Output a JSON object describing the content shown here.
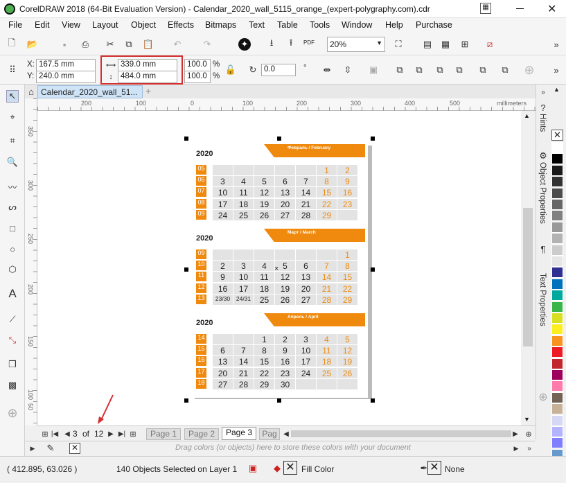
{
  "app": {
    "title": "CorelDRAW 2018 (64-Bit Evaluation Version) - Calendar_2020_wall_5115_orange_(expert-polygraphy.com).cdr"
  },
  "menu": [
    "File",
    "Edit",
    "View",
    "Layout",
    "Object",
    "Effects",
    "Bitmaps",
    "Text",
    "Table",
    "Tools",
    "Window",
    "Help",
    "Purchase"
  ],
  "toolbar": {
    "zoom": "20%",
    "pdf": "PDF"
  },
  "props": {
    "x": "167.5 mm",
    "y": "240.0 mm",
    "w": "339.0 mm",
    "h": "484.0 mm",
    "sx": "100.0",
    "sy": "100.0",
    "pct": "%",
    "angle": "0.0",
    "deg": "°"
  },
  "doc": {
    "tab": "Calendar_2020_wall_51..."
  },
  "ruler": {
    "ticks": [
      "200",
      "100",
      "0",
      "100",
      "200",
      "300",
      "400",
      "500"
    ],
    "unit": "millimeters",
    "vticks": [
      "350",
      "300",
      "250",
      "200",
      "150",
      "100",
      "50"
    ]
  },
  "pages": {
    "current": "3",
    "of": "of",
    "total": "12",
    "tabs": [
      "Page 1",
      "Page 2",
      "Page 3",
      "Pag"
    ]
  },
  "colorbar": {
    "hint": "Drag colors (or objects) here to store these colors with your document"
  },
  "status": {
    "coords": "( 412.895, 63.026 )",
    "selection": "140 Objects Selected on Layer 1",
    "fill": "Fill Color",
    "outline": "None"
  },
  "dockers": {
    "hints": "Hints",
    "object": "Object Properties",
    "text": "Text Properties"
  },
  "palette": [
    "#ffffff",
    "#000000",
    "#1a1a1a",
    "#333333",
    "#4d4d4d",
    "#666666",
    "#808080",
    "#999999",
    "#b3b3b3",
    "#cccccc",
    "#e6e6e6",
    "#2e3192",
    "#0071bc",
    "#00a99d",
    "#39b54a",
    "#d9e021",
    "#fcee21",
    "#f7931e",
    "#ed1c24",
    "#c1272d",
    "#9e005d",
    "#ff7bac",
    "#736357",
    "#c7b299",
    "#d6d6f5",
    "#b3b3ff",
    "#8080ff",
    "#6699cc"
  ],
  "calendars": [
    {
      "year": "2020",
      "month": "Февраль / February",
      "weeks": [
        "05",
        "06",
        "07",
        "08",
        "09"
      ],
      "rows": [
        [
          "",
          "",
          "",
          "",
          "",
          "1",
          "2"
        ],
        [
          "3",
          "4",
          "5",
          "6",
          "7",
          "8",
          "9"
        ],
        [
          "10",
          "11",
          "12",
          "13",
          "14",
          "15",
          "16"
        ],
        [
          "17",
          "18",
          "19",
          "20",
          "21",
          "22",
          "23"
        ],
        [
          "24",
          "25",
          "26",
          "27",
          "28",
          "29",
          ""
        ]
      ]
    },
    {
      "year": "2020",
      "month": "Март / March",
      "weeks": [
        "09",
        "10",
        "11",
        "12",
        "13"
      ],
      "rows": [
        [
          "",
          "",
          "",
          "",
          "",
          "",
          "1"
        ],
        [
          "2",
          "3",
          "4",
          "5",
          "6",
          "7",
          "8"
        ],
        [
          "9",
          "10",
          "11",
          "12",
          "13",
          "14",
          "15"
        ],
        [
          "16",
          "17",
          "18",
          "19",
          "20",
          "21",
          "22"
        ],
        [
          "23/30",
          "24/31",
          "25",
          "26",
          "27",
          "28",
          "29"
        ]
      ]
    },
    {
      "year": "2020",
      "month": "Апрель / April",
      "weeks": [
        "14",
        "15",
        "16",
        "17",
        "18"
      ],
      "rows": [
        [
          "",
          "",
          "1",
          "2",
          "3",
          "4",
          "5"
        ],
        [
          "6",
          "7",
          "8",
          "9",
          "10",
          "11",
          "12"
        ],
        [
          "13",
          "14",
          "15",
          "16",
          "17",
          "18",
          "19"
        ],
        [
          "20",
          "21",
          "22",
          "23",
          "24",
          "25",
          "26"
        ],
        [
          "27",
          "28",
          "29",
          "30",
          "",
          "",
          ""
        ]
      ]
    }
  ]
}
